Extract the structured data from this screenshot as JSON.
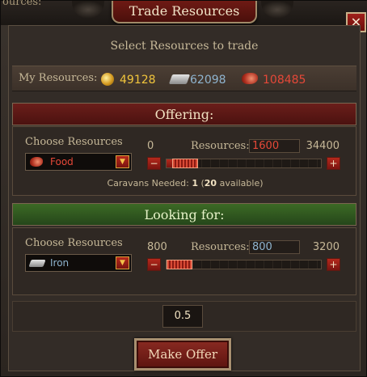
{
  "window": {
    "title": "Trade Resources",
    "corner_text": "ources:",
    "close_label": "✕",
    "subtitle": "Select Resources to trade"
  },
  "my_resources": {
    "label": "My Resources:",
    "gold": "49128",
    "iron": "62098",
    "food": "108485"
  },
  "offering": {
    "title": "Offering:",
    "choose_label": "Choose Resources",
    "selected": "Food",
    "min": "0",
    "resources_label": "Resources:",
    "amount": "1600",
    "max": "34400",
    "slider_fraction": 0.047,
    "minus_label": "−",
    "plus_label": "+",
    "caravans_prefix": "Caravans Needed:",
    "caravans_needed": "1",
    "caravans_available": "20",
    "caravans_available_suffix": "available)"
  },
  "looking_for": {
    "title": "Looking for:",
    "choose_label": "Choose Resources",
    "selected": "Iron",
    "min": "800",
    "resources_label": "Resources:",
    "amount": "800",
    "max": "3200",
    "slider_fraction": 0.0,
    "minus_label": "−",
    "plus_label": "+"
  },
  "ratio": "0.5",
  "make_offer_label": "Make Offer",
  "icons": {
    "gold": "gold-coin-icon",
    "iron": "iron-bar-icon",
    "food": "meat-icon"
  },
  "colors": {
    "gold": "#f1c53c",
    "iron": "#8fb4cf",
    "food": "#e54838",
    "offering_bar": "#6b1e1a",
    "looking_bar": "#3c6a25"
  }
}
